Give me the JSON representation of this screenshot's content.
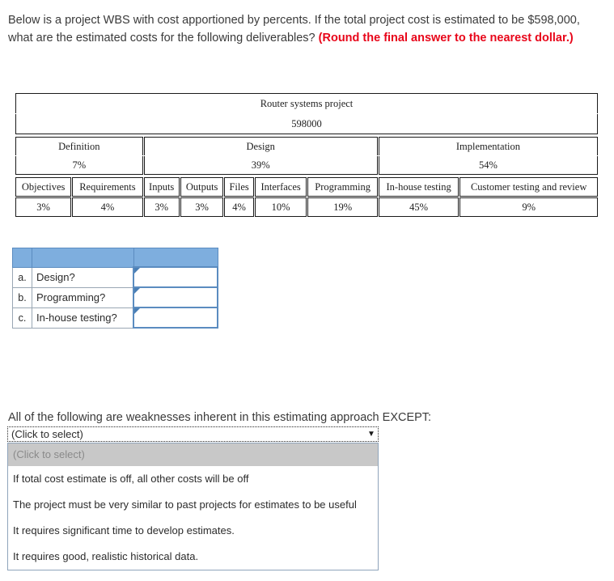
{
  "prompt": {
    "line1": "Below is a project WBS with cost apportioned by percents.  If the total project cost is estimated to be",
    "line2": "$598,000, what are the estimated costs for the following deliverables? ",
    "emphasis": "(Round the final answer to the nearest dollar.)"
  },
  "wbs": {
    "project_name": "Router systems project",
    "total_cost": "598000",
    "phases": [
      {
        "name": "Definition",
        "percent": "7%"
      },
      {
        "name": "Design",
        "percent": "39%"
      },
      {
        "name": "Implementation",
        "percent": "54%"
      }
    ],
    "deliverables": [
      {
        "name": "Objectives",
        "percent": "3%"
      },
      {
        "name": "Requirements",
        "percent": "4%"
      },
      {
        "name": "Inputs",
        "percent": "3%"
      },
      {
        "name": "Outputs",
        "percent": "3%"
      },
      {
        "name": "Files",
        "percent": "4%"
      },
      {
        "name": "Interfaces",
        "percent": "10%"
      },
      {
        "name": "Programming",
        "percent": "19%"
      },
      {
        "name": "In-house testing",
        "percent": "45%"
      },
      {
        "name": "Customer testing and review",
        "percent": "9%"
      }
    ]
  },
  "answers": {
    "header_left": "",
    "header_label": "",
    "header_value": "",
    "rows": [
      {
        "letter": "a.",
        "label": "Design?",
        "value": "",
        "placeholder": ""
      },
      {
        "letter": "b.",
        "label": "Programming?",
        "value": "",
        "placeholder": ""
      },
      {
        "letter": "c.",
        "label": "In-house testing?",
        "value": "",
        "placeholder": ""
      }
    ]
  },
  "question2": {
    "text": "All of the following are weaknesses inherent in this estimating approach EXCEPT:",
    "select_value": "(Click to select)",
    "arrow_glyph": "▼",
    "options": [
      "(Click to select)",
      "If total cost estimate is off, all other costs will be off",
      "The project must be very similar to past projects for estimates to be useful",
      "It requires significant time to develop estimates.",
      "It requires good, realistic historical data."
    ]
  },
  "colors": {
    "emphasis_red": "#e8061a",
    "header_blue": "#7eaede",
    "input_border_blue": "#5b8cc0",
    "option_highlight_gray": "#c8c8c8"
  }
}
